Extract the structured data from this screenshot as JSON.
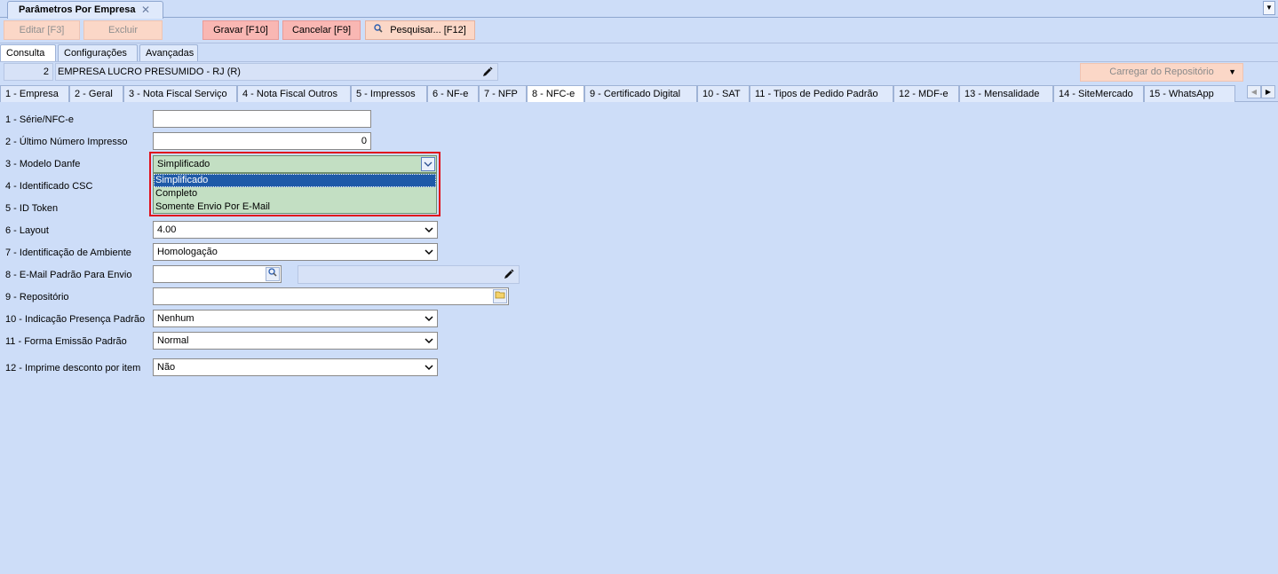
{
  "window": {
    "tab_title": "Parâmetros Por Empresa",
    "close_glyph": "✕",
    "menu_glyph": "▼"
  },
  "toolbar": {
    "edit": "Editar [F3]",
    "delete": "Excluir",
    "save": "Gravar [F10]",
    "cancel": "Cancelar [F9]",
    "search": "Pesquisar... [F12]"
  },
  "top_tabs": [
    "Consulta",
    "Configurações",
    "Avançadas"
  ],
  "company": {
    "code": "2",
    "name": "EMPRESA LUCRO PRESUMIDO - RJ  (R)"
  },
  "repo_button": "Carregar do Repositório",
  "numbered_tabs": [
    "1 - Empresa",
    "2 - Geral",
    "3 - Nota Fiscal Serviço",
    "4 - Nota Fiscal Outros",
    "5 - Impressos",
    "6 - NF-e",
    "7 - NFP",
    "8 - NFC-e",
    "9 - Certificado Digital",
    "10 - SAT",
    "11 - Tipos de Pedido Padrão",
    "12 - MDF-e",
    "13 - Mensalidade",
    "14 - SiteMercado",
    "15 - WhatsApp"
  ],
  "active_tab_index": 7,
  "form": {
    "labels": [
      "1 - Série/NFC-e",
      "2 - Último Número Impresso",
      "3 - Modelo Danfe",
      "4 - Identificado CSC",
      "5 - ID Token",
      "6 - Layout",
      "7 - Identificação de Ambiente",
      "8 - E-Mail Padrão Para Envio",
      "9 - Repositório",
      "10 - Indicação Presença Padrão",
      "11 - Forma Emissão Padrão",
      "12 - Imprime desconto por item"
    ],
    "serie": "",
    "ultimo_numero": "0",
    "modelo_danfe": {
      "selected": "Simplificado",
      "options": [
        "Simplificado",
        "Completo",
        "Somente Envio Por E-Mail"
      ]
    },
    "layout": "4.00",
    "ambiente": "Homologação",
    "email": "",
    "repositorio": "",
    "presenca": "Nenhum",
    "forma_emissao": "Normal",
    "desconto_item": "Não"
  },
  "colors": {
    "background": "#cdddf8",
    "highlight_border": "#e0101c",
    "selection": "#1e5aa8",
    "dropdown_bg": "#c3dfc3"
  }
}
